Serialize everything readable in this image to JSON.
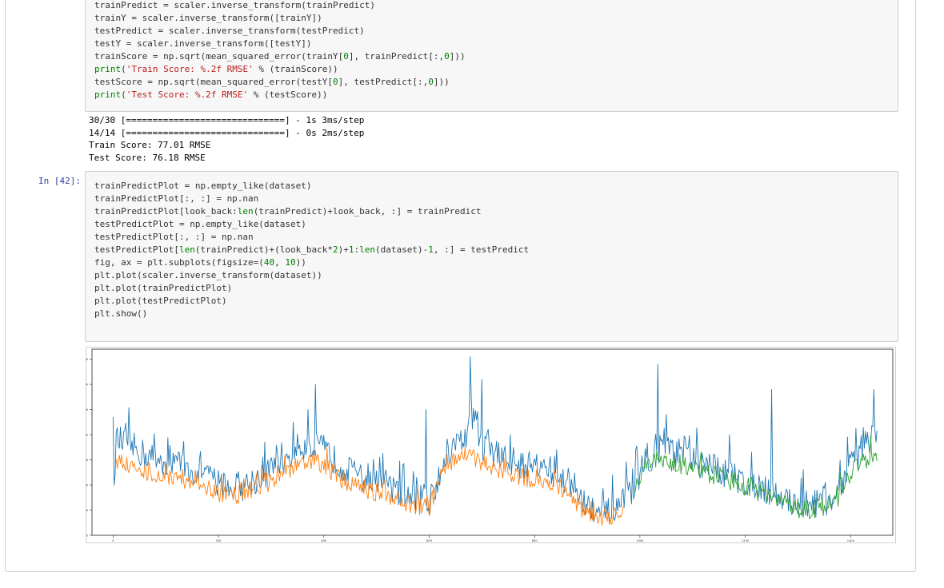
{
  "cell1": {
    "lines": [
      "trainPredict = scaler.inverse_transform(trainPredict)",
      "trainY = scaler.inverse_transform([trainY])",
      "testPredict = scaler.inverse_transform(testPredict)",
      "testY = scaler.inverse_transform([testY])",
      "trainScore = np.sqrt(mean_squared_error(trainY[0], trainPredict[:,0]))",
      "print('Train Score: %.2f RMSE' % (trainScore))",
      "testScore = np.sqrt(mean_squared_error(testY[0], testPredict[:,0]))",
      "print('Test Score: %.2f RMSE' % (testScore))"
    ],
    "output": [
      "30/30 [==============================] - 1s 3ms/step",
      "14/14 [==============================] - 0s 2ms/step",
      "Train Score: 77.01 RMSE",
      "Test Score: 76.18 RMSE"
    ]
  },
  "cell2": {
    "prompt": "In [42]:",
    "lines": [
      "trainPredictPlot = np.empty_like(dataset)",
      "trainPredictPlot[:, :] = np.nan",
      "trainPredictPlot[look_back:len(trainPredict)+look_back, :] = trainPredict",
      "testPredictPlot = np.empty_like(dataset)",
      "testPredictPlot[:, :] = np.nan",
      "testPredictPlot[len(trainPredict)+(look_back*2)+1:len(dataset)-1, :] = testPredict",
      "fig, ax = plt.subplots(figsize=(40, 10))",
      "plt.plot(scaler.inverse_transform(dataset))",
      "plt.plot(trainPredictPlot)",
      "plt.plot(testPredictPlot)",
      "plt.show()"
    ]
  },
  "chart_data": {
    "type": "line",
    "title": "",
    "xlabel": "",
    "ylabel": "",
    "xlim": [
      -40,
      1480
    ],
    "ylim": [
      0,
      740
    ],
    "xticks": [
      "0",
      "200",
      "400",
      "600",
      "800",
      "1000",
      "1200",
      "1400"
    ],
    "yticks": [
      "0",
      "100",
      "200",
      "300",
      "400",
      "500",
      "600",
      "700"
    ],
    "grid": false,
    "legend": "none",
    "colors": {
      "dataset": "#1f77b4",
      "train": "#ff7f0e",
      "test": "#2ca02c"
    },
    "series": [
      {
        "key": "dataset",
        "x_start": 0,
        "x_end": 1450,
        "anchors": [
          [
            0,
            470
          ],
          [
            2,
            145
          ],
          [
            5,
            380
          ],
          [
            30,
            360
          ],
          [
            60,
            320
          ],
          [
            90,
            300
          ],
          [
            120,
            290
          ],
          [
            150,
            250
          ],
          [
            180,
            230
          ],
          [
            210,
            200
          ],
          [
            240,
            190
          ],
          [
            270,
            220
          ],
          [
            300,
            260
          ],
          [
            330,
            310
          ],
          [
            360,
            360
          ],
          [
            380,
            350
          ],
          [
            400,
            340
          ],
          [
            420,
            300
          ],
          [
            450,
            250
          ],
          [
            480,
            220
          ],
          [
            510,
            200
          ],
          [
            540,
            170
          ],
          [
            570,
            150
          ],
          [
            600,
            130
          ],
          [
            630,
            310
          ],
          [
            650,
            360
          ],
          [
            670,
            400
          ],
          [
            680,
            490
          ],
          [
            700,
            360
          ],
          [
            730,
            320
          ],
          [
            760,
            290
          ],
          [
            800,
            270
          ],
          [
            840,
            250
          ],
          [
            870,
            200
          ],
          [
            880,
            150
          ],
          [
            900,
            110
          ],
          [
            930,
            80
          ],
          [
            960,
            100
          ],
          [
            990,
            200
          ],
          [
            1010,
            300
          ],
          [
            1040,
            340
          ],
          [
            1070,
            330
          ],
          [
            1100,
            290
          ],
          [
            1130,
            270
          ],
          [
            1160,
            250
          ],
          [
            1190,
            220
          ],
          [
            1220,
            200
          ],
          [
            1250,
            170
          ],
          [
            1280,
            140
          ],
          [
            1310,
            120
          ],
          [
            1340,
            130
          ],
          [
            1370,
            150
          ],
          [
            1400,
            290
          ],
          [
            1420,
            340
          ],
          [
            1440,
            380
          ],
          [
            1450,
            400
          ]
        ],
        "peaks": [
          [
            0,
            470
          ],
          [
            370,
            500
          ],
          [
            385,
            600
          ],
          [
            595,
            500
          ],
          [
            678,
            710
          ],
          [
            700,
            620
          ],
          [
            1035,
            680
          ],
          [
            1050,
            480
          ],
          [
            1170,
            400
          ],
          [
            1250,
            580
          ],
          [
            1445,
            580
          ]
        ]
      },
      {
        "key": "train",
        "x_start": 6,
        "x_end": 970,
        "anchors": [
          [
            6,
            300
          ],
          [
            30,
            270
          ],
          [
            60,
            250
          ],
          [
            90,
            240
          ],
          [
            120,
            230
          ],
          [
            150,
            200
          ],
          [
            180,
            180
          ],
          [
            210,
            160
          ],
          [
            240,
            160
          ],
          [
            270,
            180
          ],
          [
            300,
            210
          ],
          [
            330,
            250
          ],
          [
            360,
            290
          ],
          [
            380,
            290
          ],
          [
            400,
            280
          ],
          [
            420,
            240
          ],
          [
            450,
            200
          ],
          [
            480,
            180
          ],
          [
            510,
            160
          ],
          [
            540,
            140
          ],
          [
            570,
            120
          ],
          [
            600,
            110
          ],
          [
            630,
            270
          ],
          [
            650,
            310
          ],
          [
            670,
            330
          ],
          [
            700,
            290
          ],
          [
            730,
            260
          ],
          [
            760,
            240
          ],
          [
            800,
            220
          ],
          [
            840,
            200
          ],
          [
            870,
            160
          ],
          [
            880,
            120
          ],
          [
            900,
            90
          ],
          [
            930,
            70
          ],
          [
            960,
            80
          ],
          [
            970,
            80
          ]
        ]
      },
      {
        "key": "test",
        "x_start": 990,
        "x_end": 1450,
        "anchors": [
          [
            990,
            190
          ],
          [
            1010,
            270
          ],
          [
            1040,
            300
          ],
          [
            1070,
            290
          ],
          [
            1100,
            260
          ],
          [
            1130,
            240
          ],
          [
            1160,
            230
          ],
          [
            1190,
            200
          ],
          [
            1220,
            180
          ],
          [
            1250,
            150
          ],
          [
            1280,
            120
          ],
          [
            1310,
            100
          ],
          [
            1340,
            110
          ],
          [
            1370,
            130
          ],
          [
            1400,
            250
          ],
          [
            1420,
            280
          ],
          [
            1440,
            330
          ],
          [
            1450,
            320
          ]
        ]
      }
    ]
  }
}
